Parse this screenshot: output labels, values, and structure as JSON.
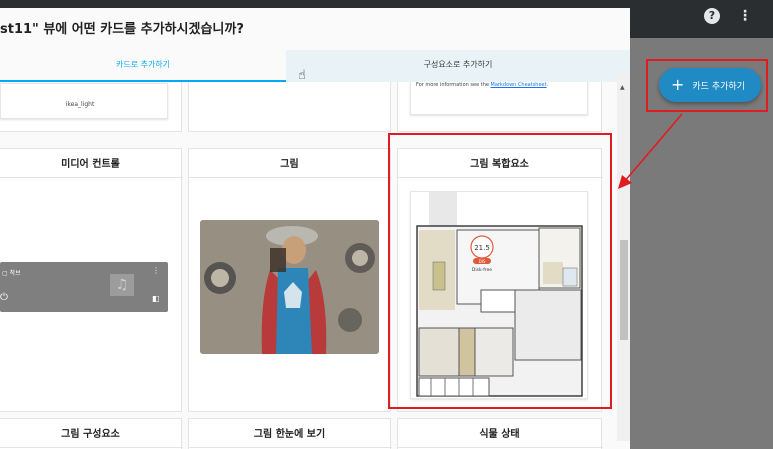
{
  "header": {
    "help_icon": "help-circle-icon",
    "help_glyph": "?",
    "more_icon": "dots-vertical-icon",
    "more_glyph": "⋮"
  },
  "dialog": {
    "title": "st11\" 뷰에 어떤 카드를 추가하시겠습니까?",
    "tabs": [
      {
        "label": "카드로 추가하기",
        "active": true
      },
      {
        "label": "구성요소로 추가하기",
        "active": false
      }
    ]
  },
  "cards_top": {
    "ikea_label": "ikea_light",
    "markdown_note_prefix": "For more information see the ",
    "markdown_note_link": "Markdown Cheatsheet",
    "markdown_note_suffix": "."
  },
  "cards": [
    {
      "title": "미디어 컨트롤",
      "media_name": "▢ 착브",
      "menu_glyph": "⋮",
      "power_glyph": "⏻",
      "art_glyph": "♫",
      "extra_glyph": "◧"
    },
    {
      "title": "그림"
    },
    {
      "title": "그림 복합요소",
      "badge_value": "21.5",
      "badge_tag": "DIS",
      "badge_label": "Disk-free"
    }
  ],
  "cards_bottom": [
    {
      "title": "그림 구성요소"
    },
    {
      "title": "그림 한눈에 보기"
    },
    {
      "title": "식물 상태"
    }
  ],
  "add_card_button": {
    "label": "카드 추가하기",
    "icon": "plus-icon",
    "glyph": "+"
  },
  "colors": {
    "accent": "#03a9f4",
    "button": "#1f8ac3",
    "highlight": "#e11b22",
    "header": "#2b2e31"
  }
}
